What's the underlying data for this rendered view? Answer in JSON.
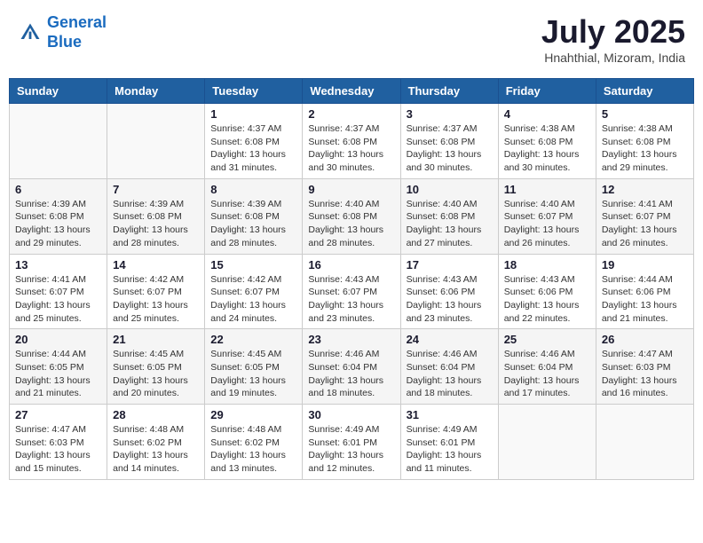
{
  "header": {
    "logo_line1": "General",
    "logo_line2": "Blue",
    "month_title": "July 2025",
    "subtitle": "Hnahthial, Mizoram, India"
  },
  "weekdays": [
    "Sunday",
    "Monday",
    "Tuesday",
    "Wednesday",
    "Thursday",
    "Friday",
    "Saturday"
  ],
  "weeks": [
    [
      {
        "day": "",
        "info": ""
      },
      {
        "day": "",
        "info": ""
      },
      {
        "day": "1",
        "info": "Sunrise: 4:37 AM\nSunset: 6:08 PM\nDaylight: 13 hours and 31 minutes."
      },
      {
        "day": "2",
        "info": "Sunrise: 4:37 AM\nSunset: 6:08 PM\nDaylight: 13 hours and 30 minutes."
      },
      {
        "day": "3",
        "info": "Sunrise: 4:37 AM\nSunset: 6:08 PM\nDaylight: 13 hours and 30 minutes."
      },
      {
        "day": "4",
        "info": "Sunrise: 4:38 AM\nSunset: 6:08 PM\nDaylight: 13 hours and 30 minutes."
      },
      {
        "day": "5",
        "info": "Sunrise: 4:38 AM\nSunset: 6:08 PM\nDaylight: 13 hours and 29 minutes."
      }
    ],
    [
      {
        "day": "6",
        "info": "Sunrise: 4:39 AM\nSunset: 6:08 PM\nDaylight: 13 hours and 29 minutes."
      },
      {
        "day": "7",
        "info": "Sunrise: 4:39 AM\nSunset: 6:08 PM\nDaylight: 13 hours and 28 minutes."
      },
      {
        "day": "8",
        "info": "Sunrise: 4:39 AM\nSunset: 6:08 PM\nDaylight: 13 hours and 28 minutes."
      },
      {
        "day": "9",
        "info": "Sunrise: 4:40 AM\nSunset: 6:08 PM\nDaylight: 13 hours and 28 minutes."
      },
      {
        "day": "10",
        "info": "Sunrise: 4:40 AM\nSunset: 6:08 PM\nDaylight: 13 hours and 27 minutes."
      },
      {
        "day": "11",
        "info": "Sunrise: 4:40 AM\nSunset: 6:07 PM\nDaylight: 13 hours and 26 minutes."
      },
      {
        "day": "12",
        "info": "Sunrise: 4:41 AM\nSunset: 6:07 PM\nDaylight: 13 hours and 26 minutes."
      }
    ],
    [
      {
        "day": "13",
        "info": "Sunrise: 4:41 AM\nSunset: 6:07 PM\nDaylight: 13 hours and 25 minutes."
      },
      {
        "day": "14",
        "info": "Sunrise: 4:42 AM\nSunset: 6:07 PM\nDaylight: 13 hours and 25 minutes."
      },
      {
        "day": "15",
        "info": "Sunrise: 4:42 AM\nSunset: 6:07 PM\nDaylight: 13 hours and 24 minutes."
      },
      {
        "day": "16",
        "info": "Sunrise: 4:43 AM\nSunset: 6:07 PM\nDaylight: 13 hours and 23 minutes."
      },
      {
        "day": "17",
        "info": "Sunrise: 4:43 AM\nSunset: 6:06 PM\nDaylight: 13 hours and 23 minutes."
      },
      {
        "day": "18",
        "info": "Sunrise: 4:43 AM\nSunset: 6:06 PM\nDaylight: 13 hours and 22 minutes."
      },
      {
        "day": "19",
        "info": "Sunrise: 4:44 AM\nSunset: 6:06 PM\nDaylight: 13 hours and 21 minutes."
      }
    ],
    [
      {
        "day": "20",
        "info": "Sunrise: 4:44 AM\nSunset: 6:05 PM\nDaylight: 13 hours and 21 minutes."
      },
      {
        "day": "21",
        "info": "Sunrise: 4:45 AM\nSunset: 6:05 PM\nDaylight: 13 hours and 20 minutes."
      },
      {
        "day": "22",
        "info": "Sunrise: 4:45 AM\nSunset: 6:05 PM\nDaylight: 13 hours and 19 minutes."
      },
      {
        "day": "23",
        "info": "Sunrise: 4:46 AM\nSunset: 6:04 PM\nDaylight: 13 hours and 18 minutes."
      },
      {
        "day": "24",
        "info": "Sunrise: 4:46 AM\nSunset: 6:04 PM\nDaylight: 13 hours and 18 minutes."
      },
      {
        "day": "25",
        "info": "Sunrise: 4:46 AM\nSunset: 6:04 PM\nDaylight: 13 hours and 17 minutes."
      },
      {
        "day": "26",
        "info": "Sunrise: 4:47 AM\nSunset: 6:03 PM\nDaylight: 13 hours and 16 minutes."
      }
    ],
    [
      {
        "day": "27",
        "info": "Sunrise: 4:47 AM\nSunset: 6:03 PM\nDaylight: 13 hours and 15 minutes."
      },
      {
        "day": "28",
        "info": "Sunrise: 4:48 AM\nSunset: 6:02 PM\nDaylight: 13 hours and 14 minutes."
      },
      {
        "day": "29",
        "info": "Sunrise: 4:48 AM\nSunset: 6:02 PM\nDaylight: 13 hours and 13 minutes."
      },
      {
        "day": "30",
        "info": "Sunrise: 4:49 AM\nSunset: 6:01 PM\nDaylight: 13 hours and 12 minutes."
      },
      {
        "day": "31",
        "info": "Sunrise: 4:49 AM\nSunset: 6:01 PM\nDaylight: 13 hours and 11 minutes."
      },
      {
        "day": "",
        "info": ""
      },
      {
        "day": "",
        "info": ""
      }
    ]
  ]
}
